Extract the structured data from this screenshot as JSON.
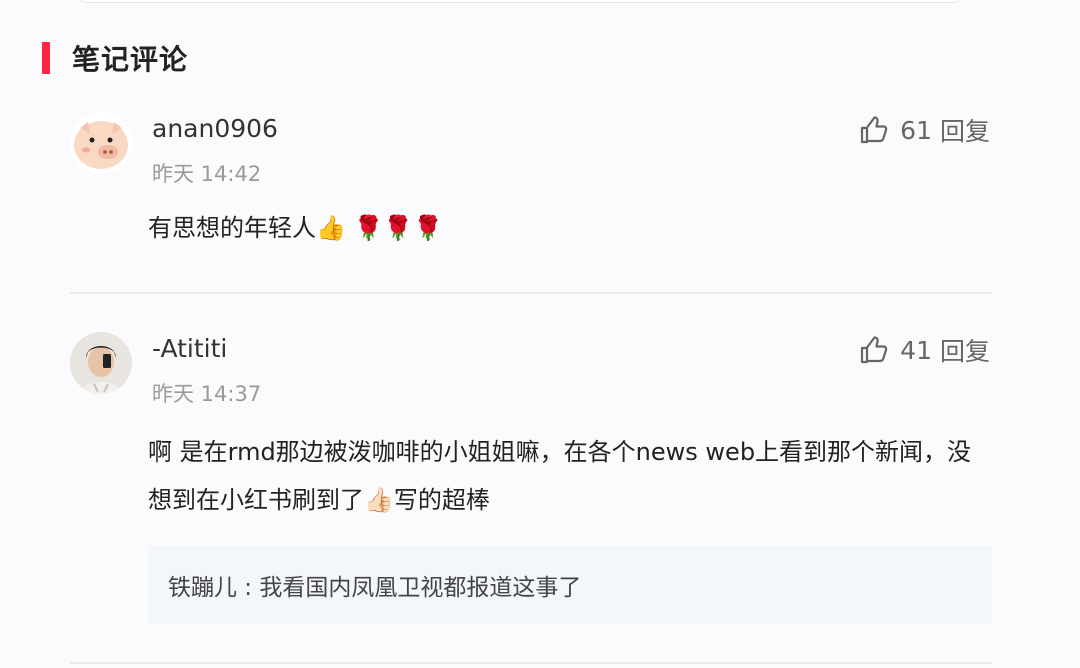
{
  "section": {
    "title": "笔记评论"
  },
  "comments": [
    {
      "author": "anan0906",
      "time": "昨天 14:42",
      "likes": "61",
      "reply_label": "回复",
      "text": "有思想的年轻人👍 🌹🌹🌹"
    },
    {
      "author": "-Atititi",
      "time": "昨天 14:37",
      "likes": "41",
      "reply_label": "回复",
      "text": "啊 是在rmd那边被泼咖啡的小姐姐嘛，在各个news web上看到那个新闻，没想到在小红书刷到了👍🏻写的超棒",
      "reply": {
        "author": "铁蹦儿",
        "separator": " : ",
        "text": "我看国内凤凰卫视都报道这事了"
      }
    }
  ]
}
